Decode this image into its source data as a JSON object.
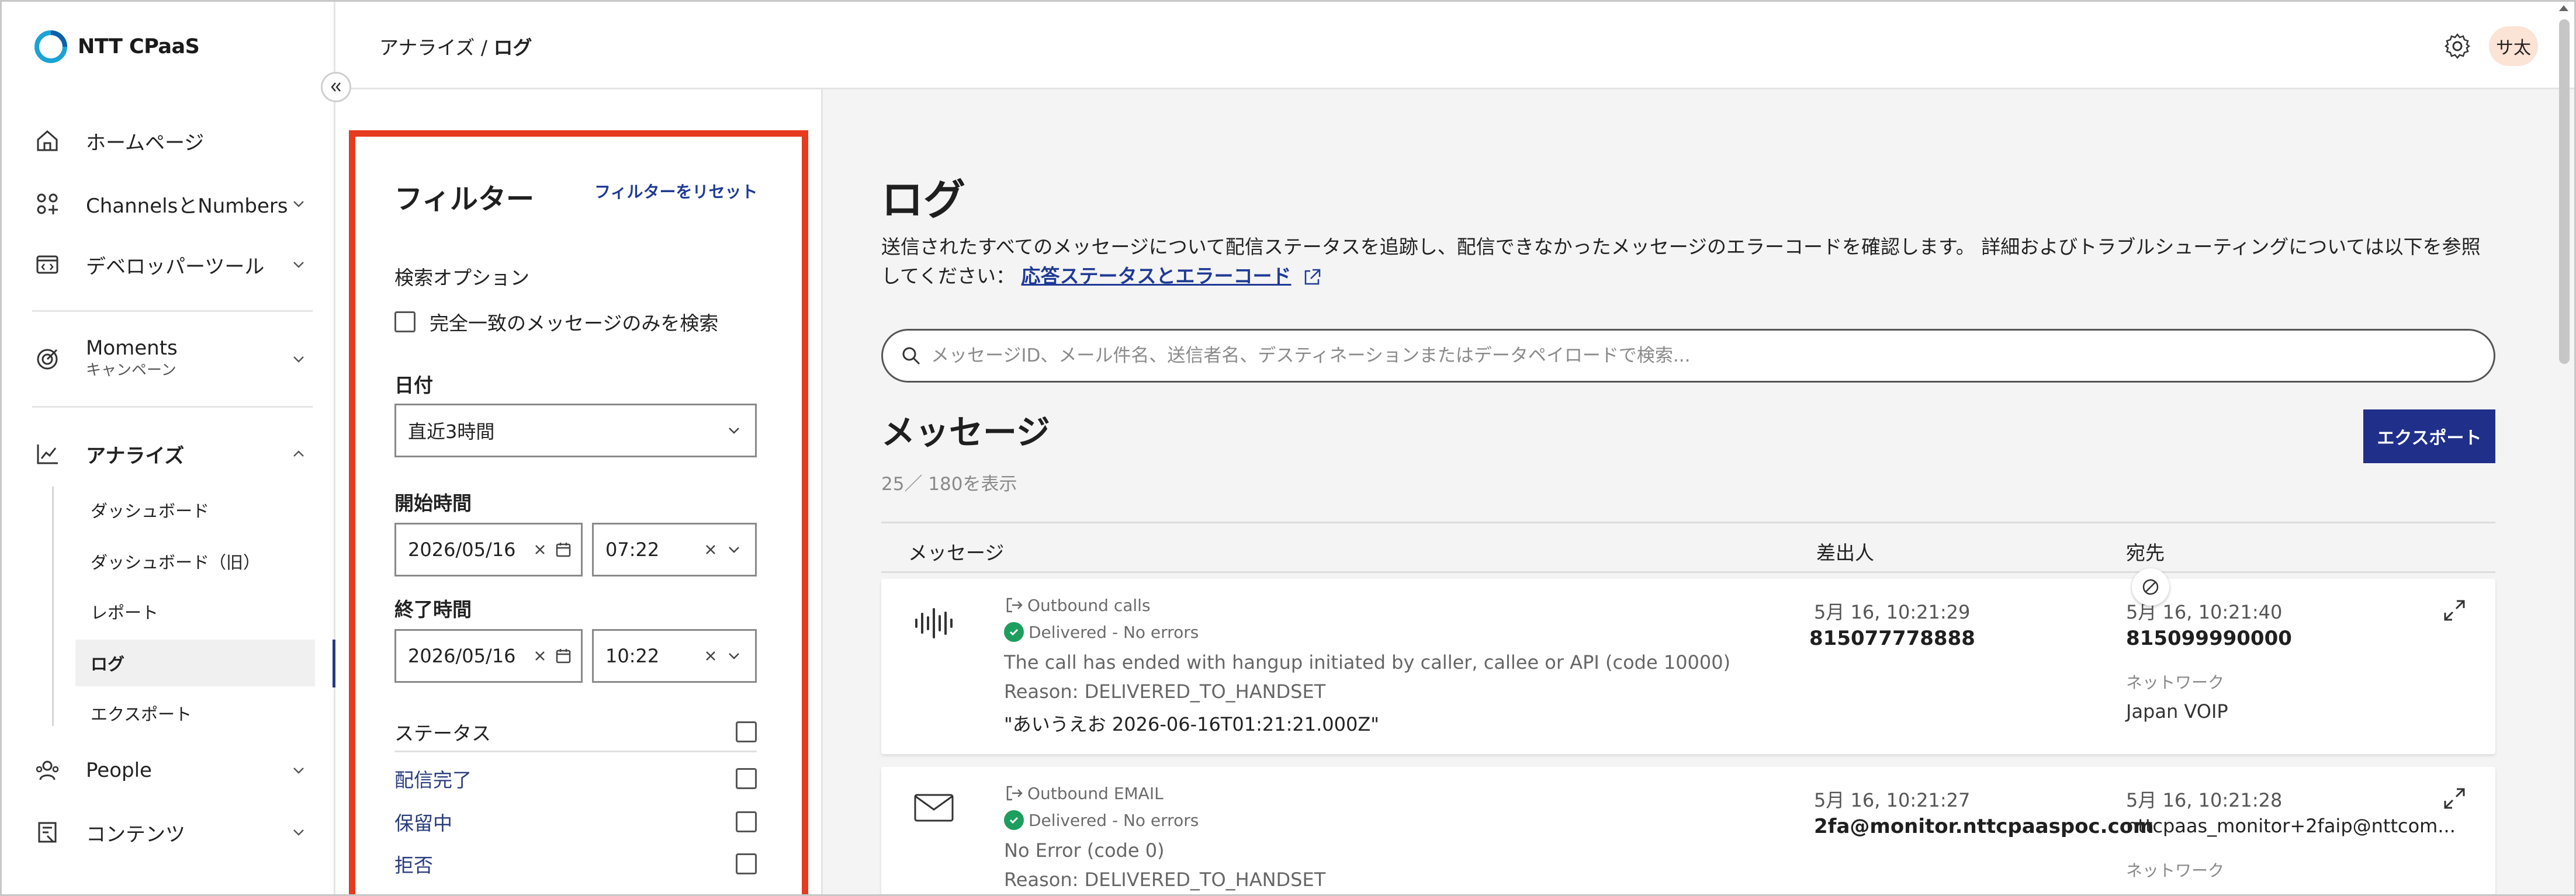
{
  "app": {
    "logo_text": "NTT CPaaS"
  },
  "breadcrumb": {
    "parent": "アナライズ",
    "separator": " / ",
    "current": "ログ"
  },
  "header": {
    "avatar_text": "サ太"
  },
  "sidebar": {
    "items": [
      {
        "label": "ホームページ",
        "icon": "home-icon"
      },
      {
        "label": "ChannelsとNumbers",
        "icon": "channels-icon"
      },
      {
        "label": "デベロッパーツール",
        "icon": "code-icon"
      },
      {
        "label": "Moments",
        "sub": "キャンペーン",
        "icon": "target-icon"
      },
      {
        "label": "アナライズ",
        "icon": "chart-icon"
      },
      {
        "label": "People",
        "icon": "people-icon"
      },
      {
        "label": "コンテンツ",
        "icon": "content-icon"
      }
    ],
    "analyze_sub": [
      "ダッシュボード",
      "ダッシュボード（旧）",
      "レポート",
      "ログ",
      "エクスポート"
    ]
  },
  "filter": {
    "title": "フィルター",
    "reset": "フィルターをリセット",
    "search_options": "検索オプション",
    "exact_match": "完全一致のメッセージのみを検索",
    "date_label": "日付",
    "date_value": "直近3時間",
    "start_label": "開始時間",
    "start_date": "2026/05/16",
    "start_time": "07:22",
    "end_label": "終了時間",
    "end_date": "2026/05/16",
    "end_time": "10:22",
    "status_label": "ステータス",
    "statuses": [
      "配信完了",
      "保留中",
      "拒否"
    ]
  },
  "main": {
    "title": "ログ",
    "description": "送信されたすべてのメッセージについて配信ステータスを追跡し、配信できなかったメッセージのエラーコードを確認します。 詳細およびトラブルシューティングについては以下を参照してください：",
    "link": "応答ステータスとエラーコード",
    "search_placeholder": "メッセージID、メール件名、送信者名、デスティネーションまたはデータペイロードで検索...",
    "messages_title": "メッセージ",
    "count": "25／ 180を表示",
    "export": "エクスポート",
    "columns": [
      "メッセージ",
      "差出人",
      "宛先"
    ]
  },
  "rows": [
    {
      "icon": "voice-waveform-icon",
      "type": "Outbound calls",
      "status": "Delivered - No errors",
      "line1": "The call has ended with hangup initiated by caller, callee or API (code 10000)",
      "line2": "Reason: DELIVERED_TO_HANDSET",
      "line3": "\"あいうえお 2026-06-16T01:21:21.000Z\"",
      "from_time": "5月 16, 10:21:29",
      "from_value": "815077778888",
      "to_time": "5月 16, 10:21:40",
      "to_value": "815099990000",
      "network_label": "ネットワーク",
      "network_value": "Japan VOIP"
    },
    {
      "icon": "envelope-icon",
      "type": "Outbound EMAIL",
      "status": "Delivered - No errors",
      "line1": "No Error (code 0)",
      "line2": "Reason: DELIVERED_TO_HANDSET",
      "from_time": "5月 16, 10:21:27",
      "from_value": "2fa@monitor.nttcpaaspoc.com",
      "to_time": "5月 16, 10:21:28",
      "to_value": "nttcpaas_monitor+2faip@nttcom...",
      "network_label": "ネットワーク"
    }
  ],
  "colors": {
    "accent": "#1f2f8a",
    "highlight": "#e63b1f",
    "success": "#1e9e5e",
    "link": "#1f3a96"
  }
}
